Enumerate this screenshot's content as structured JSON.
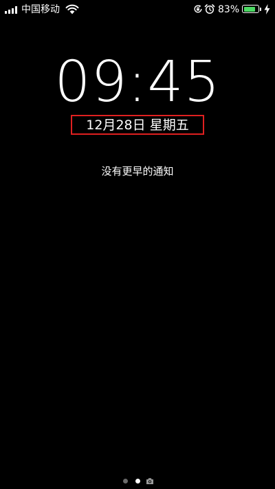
{
  "status_bar": {
    "carrier": "中国移动",
    "battery_percent": "83%",
    "battery_level": 0.83,
    "icons": [
      "signal-icon",
      "wifi-icon",
      "rotation-lock-icon",
      "alarm-icon",
      "battery-icon",
      "charging-icon"
    ]
  },
  "lock_screen": {
    "time": "09:45",
    "date": "12月28日 星期五",
    "notification_text": "没有更早的通知"
  },
  "page_indicator": {
    "pages": 3,
    "current": 2,
    "last_icon": "camera-icon"
  },
  "colors": {
    "background": "#000000",
    "text": "#ffffff",
    "battery_fill": "#4cd964",
    "highlight_box": "#e02020",
    "inactive_dot": "#6b6b6b"
  }
}
